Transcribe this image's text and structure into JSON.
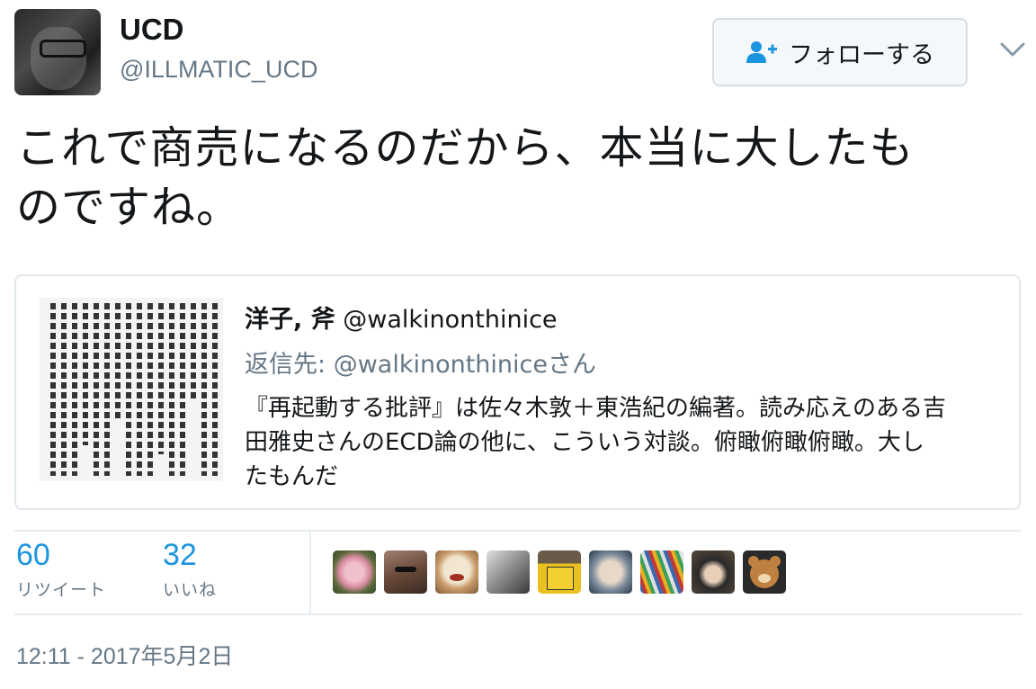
{
  "user": {
    "display_name": "UCD",
    "handle": "@ILLMATIC_UCD",
    "avatar_icon": "profile-photo"
  },
  "follow_button": {
    "label": "フォローする",
    "icon": "follow-person-plus-icon"
  },
  "menu_icon": "chevron-down-icon",
  "tweet": {
    "text_line1": "これで商売になるのだから、本当に大したも",
    "text_line2": "のですね。"
  },
  "quoted_tweet": {
    "name": "洋子, 斧",
    "handle": "@walkinonthinice",
    "reply_to_prefix": "返信先: ",
    "reply_to_handle": "@walkinonthinice",
    "reply_to_suffix": "さん",
    "text_line1": "『再起動する批評』は佐々木敦＋東浩紀の編著。読み応えのある吉",
    "text_line2": "田雅史さんのECD論の他に、こういう対談。俯瞰俯瞰俯瞰。大し",
    "text_line3": "たもんだ",
    "image_icon": "book-page-image"
  },
  "stats": {
    "retweets": {
      "count": "60",
      "label": "リツイート"
    },
    "likes": {
      "count": "32",
      "label": "いいね"
    }
  },
  "likers": [
    {
      "name": "rose-avatar",
      "color": "#e8a8b8"
    },
    {
      "name": "person-sunglasses-avatar",
      "color": "#7a5a4a"
    },
    {
      "name": "tiger-mask-avatar",
      "color": "#c89a6a"
    },
    {
      "name": "monochrome-photo-avatar",
      "color": "#9a9a9a"
    },
    {
      "name": "protest-sign-avatar",
      "color": "#d8b020"
    },
    {
      "name": "face-closeup-avatar",
      "color": "#6a8a9a"
    },
    {
      "name": "colored-pencils-avatar",
      "color": "#8aa0b0"
    },
    {
      "name": "woman-portrait-avatar",
      "color": "#4a4a4a"
    },
    {
      "name": "bear-avatar",
      "color": "#b07840"
    }
  ],
  "timestamp": "12:11 - 2017年5月2日",
  "colors": {
    "link_blue": "#1b95e0",
    "secondary_text": "#657786",
    "border": "#e1e8ed",
    "button_bg": "#f5f8fa"
  }
}
